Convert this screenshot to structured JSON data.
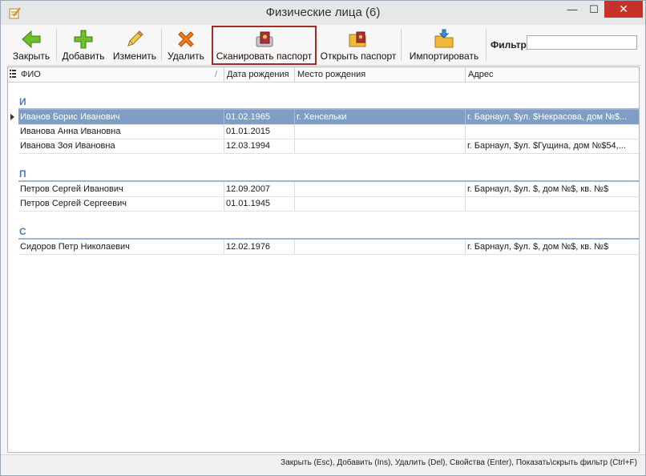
{
  "window": {
    "title": "Физические лица (6)",
    "minimize_glyph": "—",
    "maximize_glyph": "☐",
    "close_glyph": "✕"
  },
  "toolbar": {
    "close_label": "Закрыть",
    "add_label": "Добавить",
    "edit_label": "Изменить",
    "delete_label": "Удалить",
    "scan_passport_label": "Сканировать паспорт",
    "open_passport_label": "Открыть паспорт",
    "import_label": "Импортировать",
    "filter_label": "Фильтр:",
    "filter_value": ""
  },
  "grid": {
    "columns": [
      "ФИО",
      "Дата рождения",
      "Место рождения",
      "Адрес"
    ],
    "sort_glyph": "/",
    "groups": [
      {
        "letter": "И",
        "rows": [
          {
            "name": "Иванов Борис Иванович",
            "birth_date": "01.02.1965",
            "birth_place": "г. Хенсельки",
            "address": "г. Барнаул, $ул. $Некрасова, дом №$..."
          },
          {
            "name": "Иванова Анна Ивановна",
            "birth_date": "01.01.2015",
            "birth_place": "",
            "address": ""
          },
          {
            "name": "Иванова Зоя Ивановна",
            "birth_date": "12.03.1994",
            "birth_place": "",
            "address": "г. Барнаул, $ул. $Гущина, дом №$54,..."
          }
        ]
      },
      {
        "letter": "П",
        "rows": [
          {
            "name": "Петров Сергей Иванович",
            "birth_date": "12.09.2007",
            "birth_place": "",
            "address": "г. Барнаул, $ул. $, дом №$, кв. №$"
          },
          {
            "name": "Петров Сергей Сергеевич",
            "birth_date": "01.01.1945",
            "birth_place": "",
            "address": ""
          }
        ]
      },
      {
        "letter": "С",
        "rows": [
          {
            "name": "Сидоров Петр Николаевич",
            "birth_date": "12.02.1976",
            "birth_place": "",
            "address": "г. Барнаул, $ул. $, дом №$, кв. №$"
          }
        ]
      }
    ]
  },
  "statusbar": {
    "text": "Закрыть (Esc), Добавить (Ins), Удалить (Del), Свойства (Enter), Показать\\скрыть фильтр (Ctrl+F)"
  },
  "colors": {
    "selection": "#7f9dc5",
    "group_text": "#4e79b8",
    "close_button": "#c7302b",
    "highlight_border": "#a62828"
  }
}
